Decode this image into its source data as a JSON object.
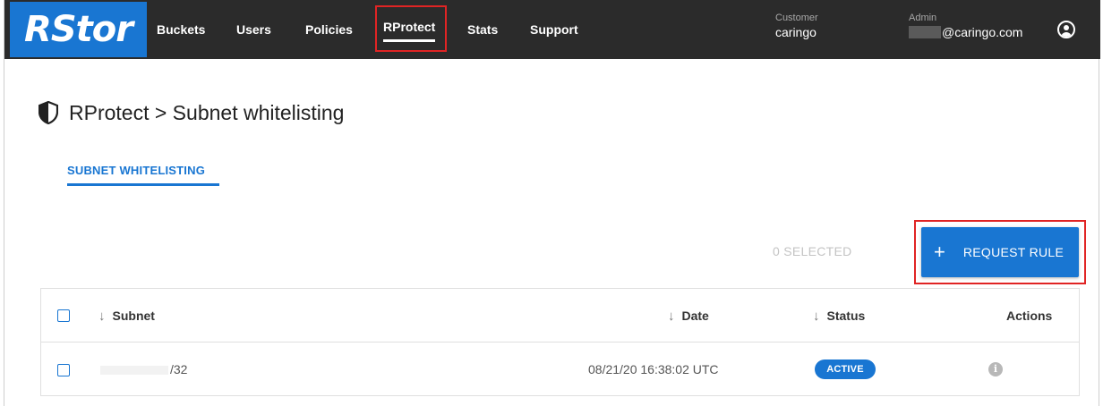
{
  "brand": {
    "logo_text": "RStor",
    "color": "#1976d2"
  },
  "nav": {
    "items": [
      {
        "label": "Buckets",
        "active": false
      },
      {
        "label": "Users",
        "active": false
      },
      {
        "label": "Policies",
        "active": false
      },
      {
        "label": "RProtect",
        "active": true
      },
      {
        "label": "Stats",
        "active": false
      },
      {
        "label": "Support",
        "active": false
      }
    ]
  },
  "account": {
    "customer_caption": "Customer",
    "customer_value": "caringo",
    "admin_caption": "Admin",
    "admin_value": "@caringo.com"
  },
  "page": {
    "title": "RProtect > Subnet whitelisting",
    "tab_label": "SUBNET WHITELISTING",
    "selected_text": "0 SELECTED",
    "request_button_label": "REQUEST RULE",
    "request_button_icon": "+"
  },
  "table": {
    "columns": [
      {
        "label": "Subnet",
        "sort_icon": "↓"
      },
      {
        "label": "Date",
        "sort_icon": "↓"
      },
      {
        "label": "Status",
        "sort_icon": "↓"
      },
      {
        "label": "Actions"
      }
    ],
    "rows": [
      {
        "subnet": "/32",
        "date": "08/21/20 16:38:02 UTC",
        "status": "ACTIVE"
      }
    ]
  },
  "colors": {
    "accent": "#1976d2",
    "navbar": "#2b2b2b",
    "highlight": "#e02424"
  }
}
